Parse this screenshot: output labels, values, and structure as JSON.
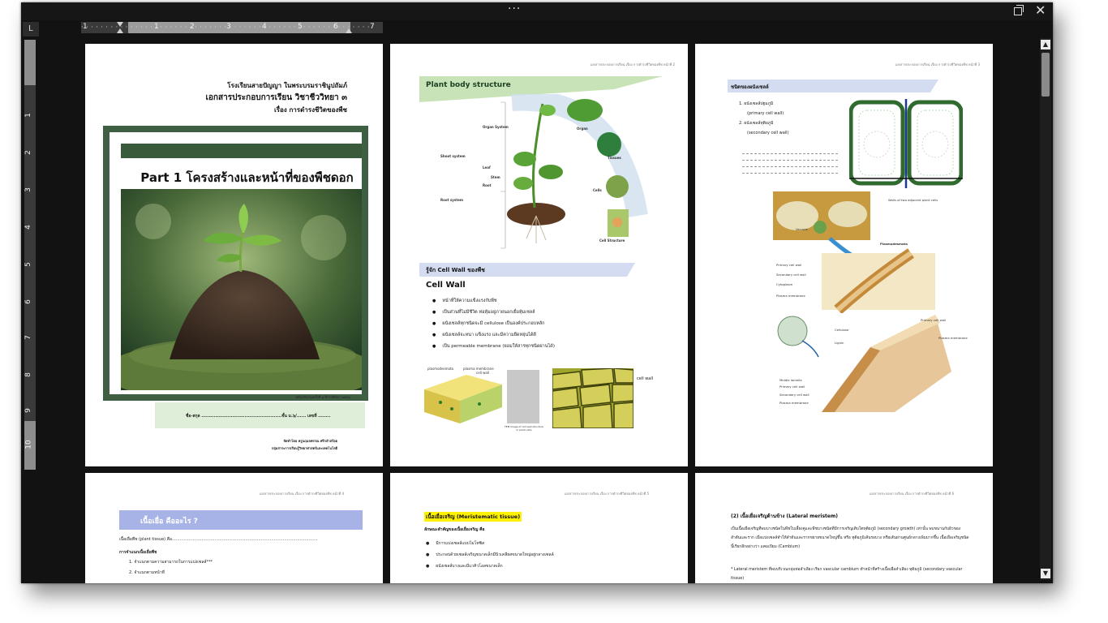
{
  "window": {
    "menu_dots": "···",
    "restore_label": "",
    "close_label": "✕"
  },
  "ruler": {
    "tab_selector": "L",
    "h_numbers": [
      "1",
      "1",
      "2",
      "3",
      "4",
      "5",
      "6",
      "7"
    ],
    "v_numbers": [
      "1",
      "2",
      "3",
      "4",
      "5",
      "6",
      "7",
      "8",
      "9",
      "10"
    ]
  },
  "pages": {
    "p1": {
      "school": "โรงเรียนสายปัญญา ในพระบรมราชินูปถัมภ์",
      "doc_title": "เอกสารประกอบการเรียน วิชาชีววิทยา ๓",
      "topic": "เรื่อง  การดำรงชีวิตของพืช",
      "cover_title": "Part 1 โครงสร้างและหน้าที่ของพืชดอก",
      "edition": "ฉบับปรับปรุงครั้งที่ ๑ ปีการศึกษา ๒๕๖๖",
      "name_line": "ชื่อ-สกุล ....................................................ชั้น ม.๖/...... เลขที่ ........",
      "prepared_by": "จัดทำโดย ครูนฤมลพรรณ ศรีกลำสร้อย",
      "department": "กลุ่มสาระการเรียนรู้วิทยาศาสตร์และเทคโนโลยี"
    },
    "header_text": "เอกสารประกอบการเรียน เรื่อง การดำรงชีวิตของพืช หน้าที่ 2",
    "header_text_p3": "เอกสารประกอบการเรียน เรื่อง การดำรงชีวิตของพืช หน้าที่ 3",
    "header_text_p4": "เอกสารประกอบการเรียน เรื่อง การดำรงชีวิตของพืช หน้าที่ 4",
    "header_text_p5": "เอกสารประกอบการเรียน เรื่อง การดำรงชีวิตของพืช หน้าที่ 5",
    "header_text_p6": "เอกสารประกอบการเรียน เรื่อง การดำรงชีวิตของพืช หน้าที่ 6",
    "p2": {
      "banner": "Plant body structure",
      "labels": {
        "organ_system": "Organ System",
        "organ": "Organ",
        "tissues": "Tissues",
        "shoot_system": "Shoot system",
        "leaf": "Leaf",
        "stem": "Stem",
        "root": "Root",
        "root_system": "Root system",
        "cells": "Cells",
        "cell_structure": "Cell Structure"
      },
      "section_banner": "รู้จัก Cell Wall ของพืช",
      "section_title": "Cell Wall",
      "bullets": [
        "หน้าที่ให้ความแข็งแรงกับพืช",
        "เป็นส่วนที่ไม่มีชีวิต ห่อหุ้มอยู่ภายนอกเยื่อหุ้มเซลล์",
        "ผนังเซลล์ทุกชนิดจะมี cellulose เป็นองค์ประกอบหลัก",
        "ผนังเซลล์จะหนา แข็งแรง และมีความยืดหยุ่นได้ดี",
        "เป็น permeable membrane  (ยอมให้สารทุกชนิดผ่านได้)"
      ],
      "fig_labels": {
        "plasmodesmata": "plasmodesmata",
        "plasma_membrane": "plasma membrane",
        "cell_wall_small": "cell wall",
        "tem_caption": "TEM image of cell wall structure in plant cells",
        "cell_wall": "cell wall"
      }
    },
    "p3": {
      "banner": "ชนิดของผนังเซลล์",
      "items": [
        "1.  ผนังเซลล์ปฐมภูมิ",
        "(primary cell wall)",
        "2.  ผนังเซลล์ทุติยภูมิ",
        "(secondary cell wall)"
      ],
      "plasmo_labels": {
        "walls": "Walls of two adjacent plant cells",
        "vacuole": "Vacuole",
        "plasmodesmata": "Plasmodesmata",
        "primary": "Primary cell wall",
        "secondary": "Secondary cell wall",
        "cytoplasm": "Cytoplasm",
        "plasma": "Plasma membrane"
      },
      "wall_labels": {
        "cellulose": "Cellulose",
        "lignin": "Lignin",
        "primary": "Primary cell wall",
        "plasma": "Plasma membrane",
        "middle": "Middle lamella",
        "primary2": "Primary cell wall",
        "secondary": "Secondary cell wall",
        "plasma2": "Plasma membrane"
      }
    },
    "p4": {
      "banner": "เนื้อเยื่อ คืออะไร ?",
      "line1": "เนื้อเยื่อพืช (plant tissue) คือ.................................................................................................................",
      "line2": "การจำแนกเนื้อเยื่อพืช",
      "line3": "1. จำแนกตามความสามารถในการแบ่งเซลล์***",
      "line4": "2. จำแนกตามหน้าที่"
    },
    "p5": {
      "title": "เนื้อเยื่อเจริญ (Meristematic tissue)",
      "subtitle": "ลักษณะสำคัญของเนื้อเยื่อเจริญ คือ",
      "bullets": [
        "มีการแบ่งเซลล์แบบไมโทซิส",
        "ประกอบด้วยเซลล์เจริญขนาดเล็กมีนิวเคลียสขนาดใหญ่อยู่กลางเซลล์",
        "ผนังเซลล์บางและมีแวคิวโอลขนาดเล็ก"
      ]
    },
    "p6": {
      "title": "(2) เนื้อเยื่อเจริญด้านข้าง (Lateral meristem)",
      "para1": "เป็นเนื้อเยื่อเจริญที่พบบางชนิดในพืชใบเลี้ยงคู่และพืชบางชนิดที่มีการเจริญเติบโตทุติยภูมิ (secondary growth) เท่านั้น พบขนานกับผิวของลำต้นและราก เมื่อแบ่งเซลล์ทำให้ลำต้นและรากขยายขนาดใหญ่ขึ้น หรือ ทุติยภูมิเส้นรอบวง หรือเส้นผ่านศูนย์กลางเพิ่มมากขึ้น  เนื้อเยื่อเจริญชนิดนี้เรียกอีกอย่างว่า แคมเบียม (Cambium)",
      "para2": "* Lateral meristem ที่พบบริเวณกลุ่มท่อลำเลียง เรียก vascular cambium ทำหน้าที่สร้างเนื้อเยื่อลำเลียง ทุติยภูมิ (secondary vascular tissue)"
    }
  },
  "colors": {
    "window_bg": "#121212",
    "cover_frame": "#3f5f43",
    "green_banner": "#c9e3b8",
    "blue_banner": "#d3dcf0",
    "p4_banner": "#a7b3e6",
    "highlight": "#fff200"
  },
  "icons": {
    "restore": "restore-window-icon",
    "close": "close-icon",
    "scroll_up": "triangle-up-icon",
    "scroll_down": "triangle-down-icon"
  }
}
